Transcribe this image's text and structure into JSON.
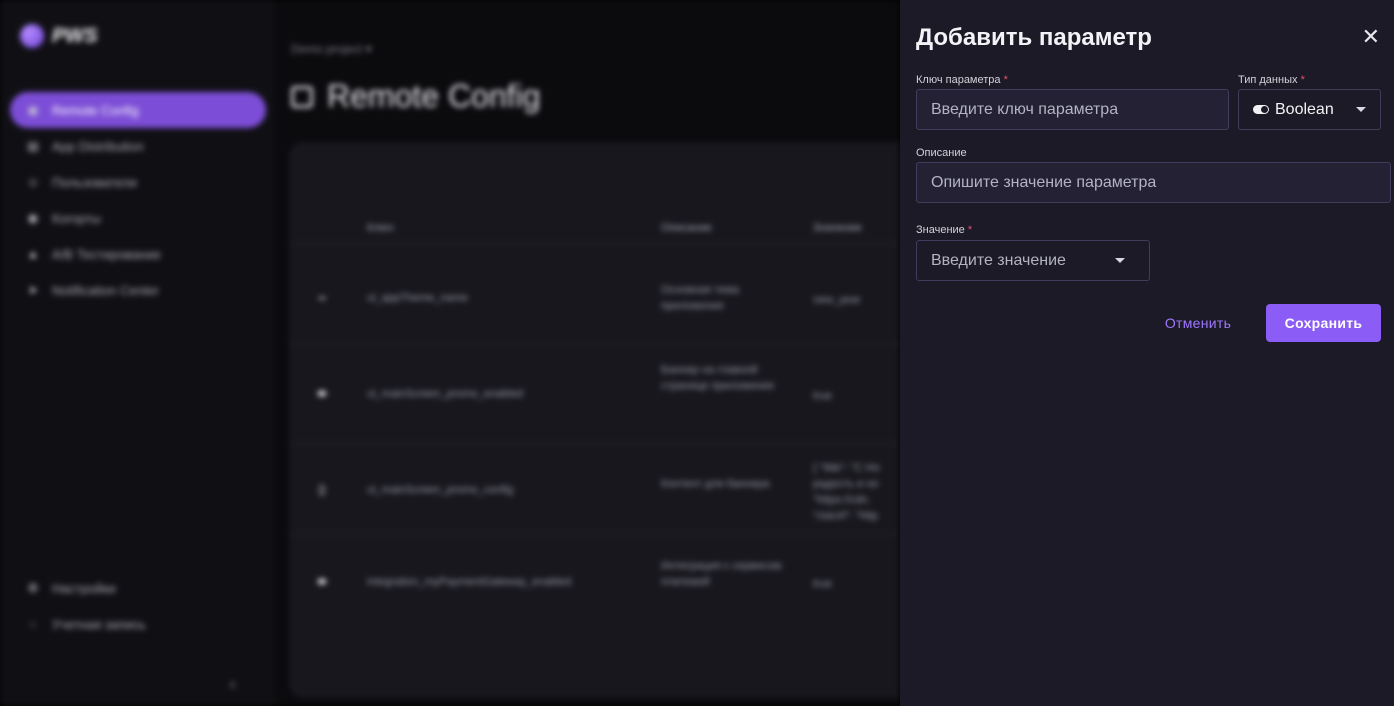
{
  "app": {
    "logo": "PWS",
    "nav": [
      {
        "label": "Remote Config",
        "icon": "remote-config-icon",
        "active": true
      },
      {
        "label": "App Distribution",
        "icon": "box-icon"
      },
      {
        "label": "Пользователи",
        "icon": "users-icon"
      },
      {
        "label": "Когорты",
        "icon": "cohorts-icon"
      },
      {
        "label": "A/B Тестирование",
        "icon": "flask-icon"
      },
      {
        "label": "Notification Center",
        "icon": "send-icon"
      }
    ],
    "nav_bottom": [
      {
        "label": "Настройки",
        "icon": "gear-icon"
      },
      {
        "label": "Учетная запись",
        "icon": "avatar-icon"
      }
    ],
    "collapse_glyph": "‹",
    "project": "Demo project",
    "page_title": "Remote Config",
    "table": {
      "headers": [
        "Ключ",
        "Описание",
        "Значение"
      ],
      "rows": [
        {
          "icon": "━",
          "key": "ui_appTheme_name",
          "desc": "Основная тема приложения",
          "value": "new_year"
        },
        {
          "icon": "⬬",
          "key": "ui_mainScreen_promo_enabled",
          "desc": "Баннер на главной странице приложения",
          "value": "true"
        },
        {
          "icon": "{}",
          "key": "ui_mainScreen_promo_config",
          "desc": "Контент для баннера",
          "value": "{ \"title\": \"С Но радость и но \"https://cdn. \"ctaUrl\": \"http"
        },
        {
          "icon": "⬬",
          "key": "integration_myPaymentGateway_enabled",
          "desc": "Интеграция с сервисом платежей",
          "value": "true"
        }
      ]
    }
  },
  "drawer": {
    "title": "Добавить параметр",
    "close_glyph": "✕",
    "key_label": "Ключ параметра",
    "key_placeholder": "Введите ключ параметра",
    "type_label": "Тип данных",
    "type_value": "Boolean",
    "desc_label": "Описание",
    "desc_placeholder": "Опишите значение параметра",
    "value_label": "Значение",
    "value_placeholder": "Введите значение",
    "required_mark": "*",
    "cancel": "Отменить",
    "save": "Сохранить"
  }
}
